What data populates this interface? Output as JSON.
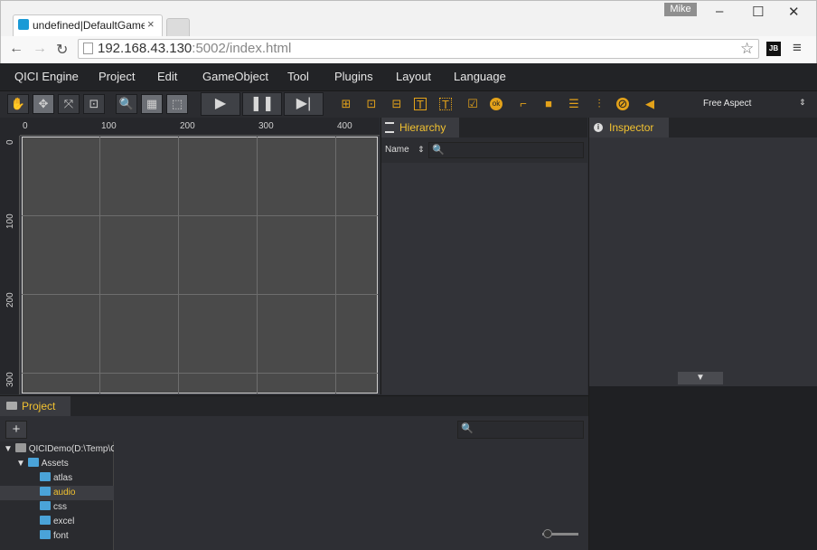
{
  "browser": {
    "tab_title": "undefined|DefaultGame|D",
    "tab_close": "×",
    "user_badge": "Mike",
    "window_controls": [
      "–",
      "☐",
      "✕"
    ],
    "nav": {
      "back": "←",
      "forward": "→",
      "reload": "↻"
    },
    "url_host": "192.168.43.130",
    "url_rest": ":5002/index.html",
    "bookmark": "☆",
    "ext": "JB",
    "menu": "≡"
  },
  "app": {
    "menu": [
      "QICI Engine",
      "Project",
      "Edit",
      "GameObject",
      "Tool",
      "Plugins",
      "Layout",
      "Language"
    ],
    "toolbar": {
      "transform_icons": [
        "✋",
        "✥",
        "⤧",
        "⊡"
      ],
      "view_icons": [
        "🔍",
        "▦",
        "⬚"
      ],
      "play": "▶",
      "pause": "❚❚",
      "step": "▶|",
      "create_icons": [
        "⊞",
        "⊡",
        "⊟",
        "T",
        "T",
        "☑",
        "ok",
        "⌐",
        "■",
        "☰",
        "⫶",
        "⊘",
        "◀"
      ],
      "aspect": "Free Aspect",
      "aspect_arrow": "⇕"
    },
    "scene": {
      "hticks": [
        "0",
        "100",
        "200",
        "300",
        "400"
      ],
      "vticks": [
        "0",
        "100",
        "200",
        "300"
      ]
    },
    "hierarchy": {
      "title": "Hierarchy",
      "filter_label": "Name",
      "filter_arrow": "⇕",
      "search_icon": "🔍"
    },
    "inspector": {
      "title": "Inspector",
      "expand": "▼"
    },
    "project": {
      "title": "Project",
      "add": "+",
      "search_icon": "🔍",
      "tree": [
        {
          "label": "QICIDemo(D:\\Temp\\Q",
          "indent": 0,
          "arrow": "▼",
          "selected": false
        },
        {
          "label": "Assets",
          "indent": 1,
          "arrow": "▼",
          "selected": false
        },
        {
          "label": "atlas",
          "indent": 2,
          "arrow": "",
          "selected": false
        },
        {
          "label": "audio",
          "indent": 2,
          "arrow": "",
          "selected": true
        },
        {
          "label": "css",
          "indent": 2,
          "arrow": "",
          "selected": false
        },
        {
          "label": "excel",
          "indent": 2,
          "arrow": "",
          "selected": false
        },
        {
          "label": "font",
          "indent": 2,
          "arrow": "",
          "selected": false
        }
      ]
    }
  },
  "colors": {
    "accent": "#f2c230",
    "panel": "#323338",
    "canvas": "#4a4a4a"
  }
}
